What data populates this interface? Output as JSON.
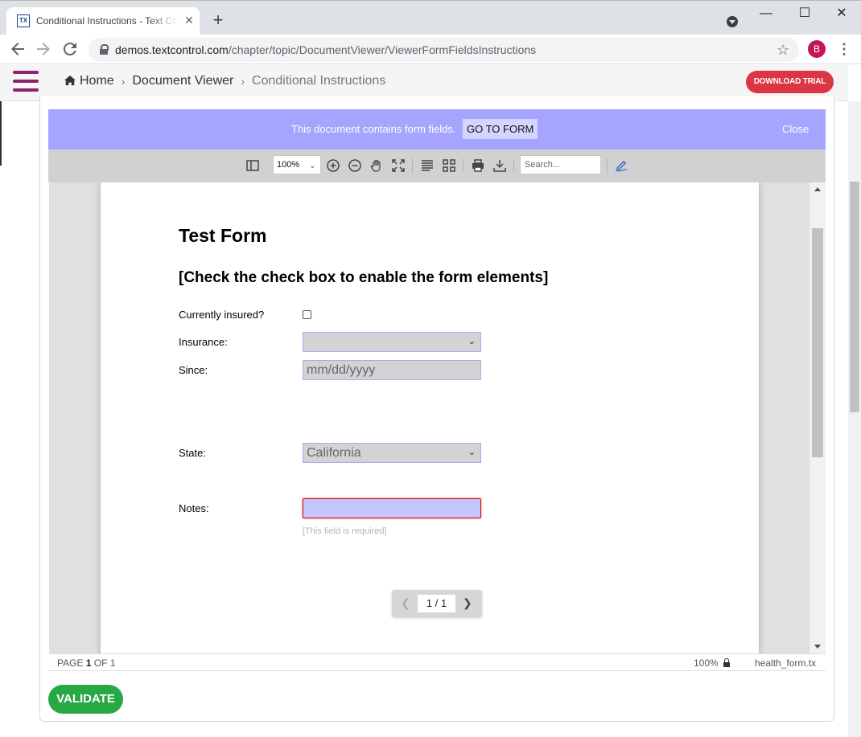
{
  "browser": {
    "tab_title": "Conditional Instructions - Text Control",
    "favicon_text": "TX",
    "tab_close": "✕",
    "new_tab": "+",
    "url_host": "demos.textcontrol.com",
    "url_path": "/chapter/topic/DocumentViewer/ViewerFormFieldsInstructions",
    "profile_initial": "B",
    "window_controls": {
      "minimize": "—",
      "maximize": "☐",
      "close": "✕"
    }
  },
  "site_header": {
    "breadcrumb": [
      "Home",
      "Document Viewer",
      "Conditional Instructions"
    ],
    "breadcrumb_separator": "›",
    "download_button": "DOWNLOAD TRIAL",
    "brand_color": "#8b2270",
    "download_color": "#dc3545"
  },
  "banner": {
    "message": "This document contains form fields.",
    "goto_button": "GO TO FORM",
    "close_label": "Close",
    "color": "#a5a5ff"
  },
  "viewer_toolbar": {
    "zoom_value": "100%",
    "search_placeholder": "Search...",
    "icons": [
      "sidebar-toggle-icon",
      "zoom-in-icon",
      "zoom-out-icon",
      "pan-hand-icon",
      "fit-screen-icon",
      "single-page-icon",
      "thumbnails-icon",
      "print-icon",
      "download-icon",
      "signature-icon"
    ]
  },
  "document": {
    "title": "Test Form",
    "subtitle": "[Check the check box to enable the form elements]",
    "fields": {
      "insured_label": "Currently insured?",
      "insurance_label": "Insurance:",
      "insurance_value": "",
      "since_label": "Since:",
      "since_placeholder": "mm/dd/yyyy",
      "state_label": "State:",
      "state_value": "California",
      "notes_label": "Notes:",
      "notes_value": "",
      "notes_required": "[This field is required]"
    },
    "pager": {
      "current": "1 / 1"
    }
  },
  "status_bar": {
    "page_prefix": "PAGE",
    "page_current": "1",
    "page_suffix": "OF 1",
    "zoom": "100%",
    "filename": "health_form.tx"
  },
  "actions": {
    "validate_button": "VALIDATE",
    "validate_color": "#28a745"
  }
}
